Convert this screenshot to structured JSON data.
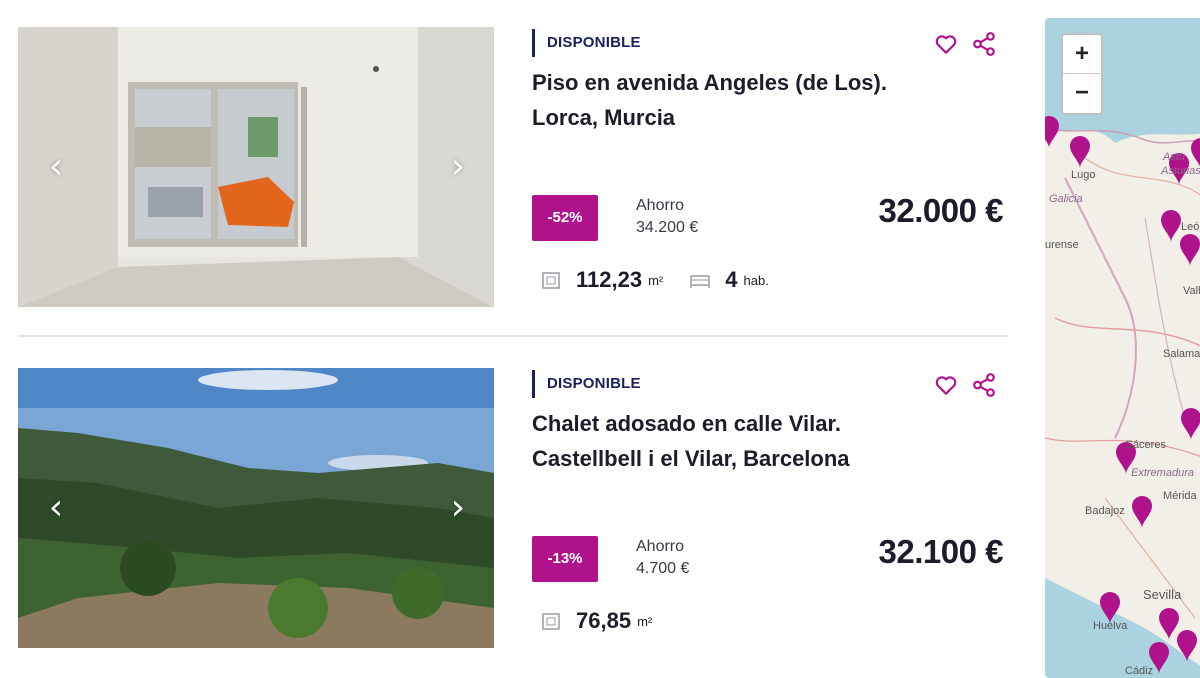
{
  "colors": {
    "accent": "#b0128c",
    "status": "#1b1f5e",
    "marker": "#b0128c"
  },
  "listings": [
    {
      "status": "DISPONIBLE",
      "title": "Piso en avenida Angeles (de Los). Lorca, Murcia",
      "discount": "-52%",
      "saving_label": "Ahorro",
      "saving_amount": "34.200 €",
      "price": "32.000 €",
      "area": "112,23",
      "area_unit": "m²",
      "rooms": "4",
      "rooms_unit": "hab."
    },
    {
      "status": "DISPONIBLE",
      "title": "Chalet adosado en calle Vilar. Castellbell i el Vilar, Barcelona",
      "discount": "-13%",
      "saving_label": "Ahorro",
      "saving_amount": "4.700 €",
      "price": "32.100 €",
      "area": "76,85",
      "area_unit": "m²"
    }
  ],
  "icons": {
    "favorite": "heart-icon",
    "share": "share-icon",
    "area": "area-icon",
    "bed": "bed-icon",
    "prev": "chevron-left-icon",
    "next": "chevron-right-icon"
  },
  "map": {
    "zoom_in": "+",
    "zoom_out": "−",
    "labels": [
      "Lugo",
      "Astu",
      "Asturias",
      "Galicia",
      "Leó",
      "urense",
      "Vall",
      "Salaman",
      "Cáceres",
      "Extremadura",
      "Mérida",
      "Badajoz",
      "Sevilla",
      "Huelva",
      "Cádiz"
    ]
  }
}
